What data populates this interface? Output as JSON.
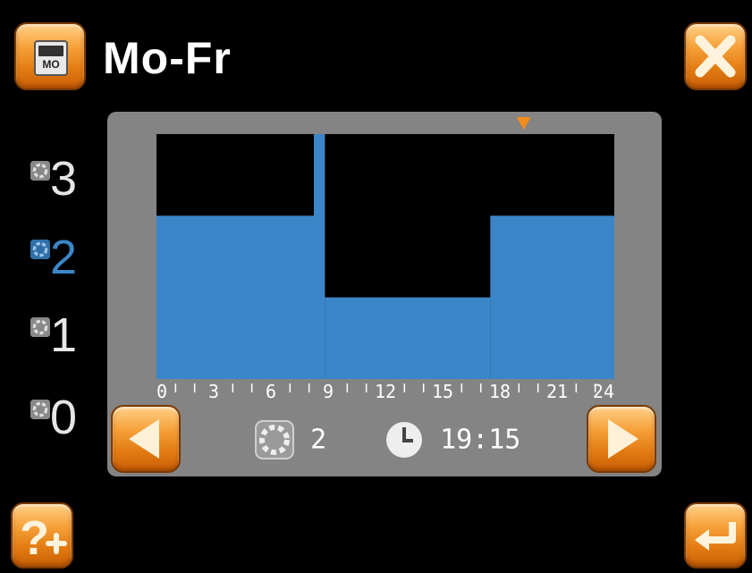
{
  "header": {
    "title": "Mo-Fr",
    "mode_icon_label": "MO"
  },
  "levels": [
    "3",
    "2",
    "1",
    "0"
  ],
  "schedule": {
    "active_level": "2",
    "current_time": "19:15",
    "marker_hour": 19.25,
    "x_range": [
      0,
      24
    ],
    "x_ticks": [
      "0",
      "3",
      "6",
      "9",
      "12",
      "15",
      "18",
      "21",
      "24"
    ],
    "y_range": [
      0,
      3
    ],
    "segments": [
      {
        "start": 0,
        "end": 8.25,
        "level": 2
      },
      {
        "start": 8.25,
        "end": 8.83,
        "level": 3
      },
      {
        "start": 8.83,
        "end": 17.5,
        "level": 1
      },
      {
        "start": 17.5,
        "end": 24,
        "level": 2
      }
    ]
  },
  "colors": {
    "bar": "#3b86c8",
    "accent": "#f28d1c",
    "active_level": "#3b86c8"
  },
  "buttons": {
    "mode": "mode-button",
    "close": "close-icon",
    "prev": "triangle-left-icon",
    "next": "triangle-right-icon",
    "help": "help-plus-icon",
    "enter": "enter-arrow-icon"
  }
}
